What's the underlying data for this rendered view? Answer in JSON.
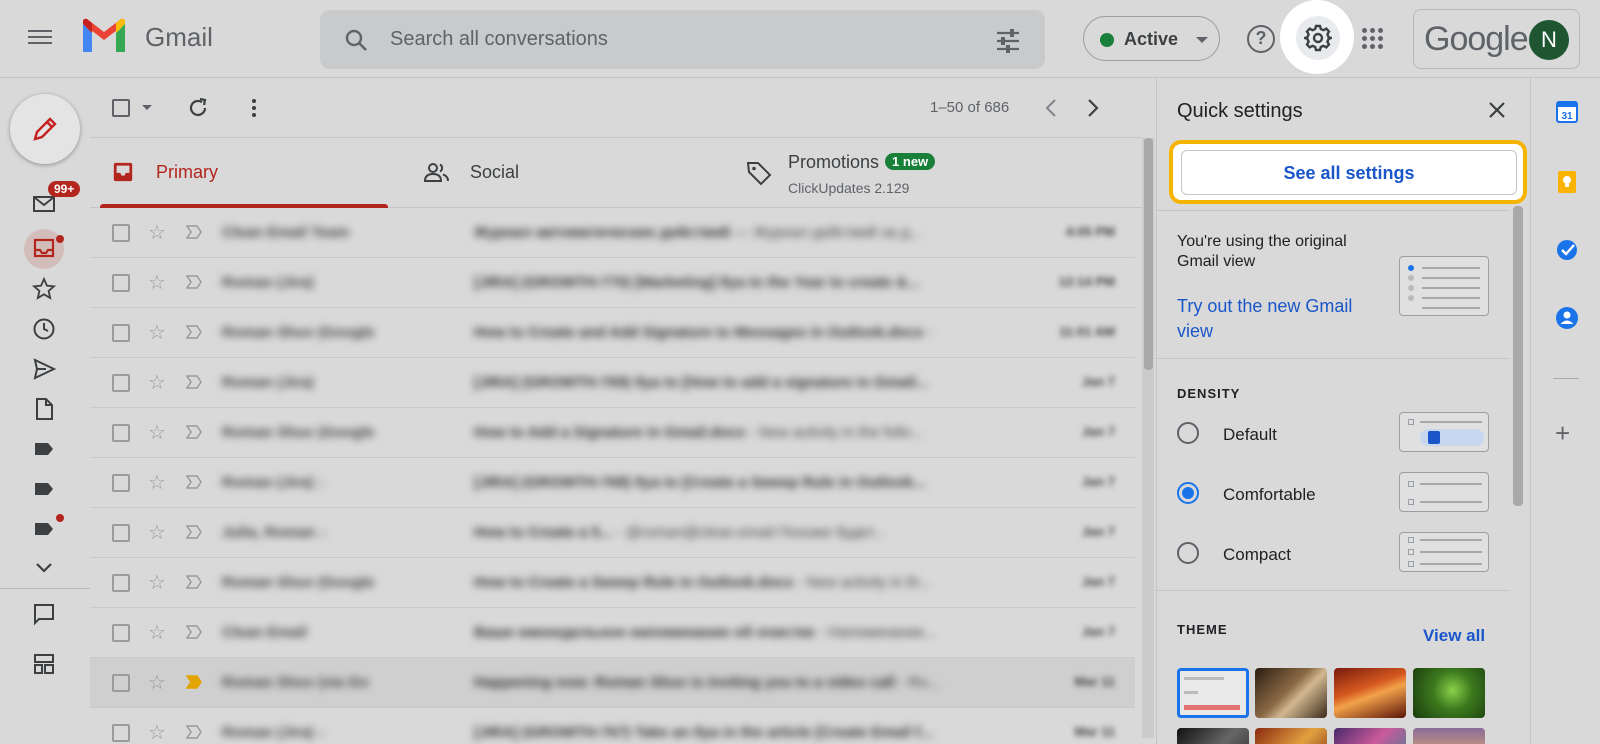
{
  "header": {
    "app_name": "Gmail",
    "search_placeholder": "Search all conversations",
    "status_label": "Active",
    "help_glyph": "?",
    "google_label": "Google",
    "avatar_initial": "N"
  },
  "rail": {
    "inbox_badge": "99+"
  },
  "toolbar": {
    "count": "1–50 of 686"
  },
  "tabs": [
    {
      "label": "Primary"
    },
    {
      "label": "Social"
    },
    {
      "label": "Promotions",
      "badge": "1 new",
      "subtitle": "ClickUpdates 2.129"
    }
  ],
  "emails": [
    {
      "sender": "Clean Email Team",
      "subject": "Журнал автоматических действий",
      "snippet": " — Журнал действий за д...",
      "date": "4:05 PM"
    },
    {
      "sender": "Roman (Jira)",
      "subject": "[JIRA] (GROWTH-770) [Marketing] Ilya to the Year to create &...",
      "snippet": "",
      "date": "12:14 PM"
    },
    {
      "sender": "Roman Shuv (Google",
      "subject": "How to Create and Add Signature to Messages in Outlook.docx",
      "snippet": " - ",
      "date": "11:01 AM"
    },
    {
      "sender": "Roman (Jira)",
      "subject": "[JIRA] (GROWTH-769) Ilya to [How to add a signature in Gmail...",
      "snippet": "",
      "date": "Jan 7"
    },
    {
      "sender": "Roman Shuv (Google",
      "subject": "How to Add a Signature in Gmail.docx",
      "snippet": " - New activity in the follo...",
      "date": "Jan 7"
    },
    {
      "sender": "Roman (Jira) ↓",
      "subject": "[JIRA] (GROWTH-768) Ilya to [Create a Sweep Rule in Outlook...",
      "snippet": "",
      "date": "Jan 7"
    },
    {
      "sender": "Julia, Roman ↓",
      "subject": "How to Create a 5...",
      "snippet": " - @roman@clean.email Похоже будет...",
      "date": "Jan 7"
    },
    {
      "sender": "Roman Shuv (Google",
      "subject": "How to Create a Sweep Rule in Outlook.docx",
      "snippet": " - New activity in th...",
      "date": "Jan 7"
    },
    {
      "sender": "Clean Email",
      "subject": "Ваше еженедельное напоминание об очистке",
      "snippet": " - Напоминание...",
      "date": "Jan 7"
    },
    {
      "sender": "Roman Shuv (via Go",
      "subject": "Happening now: Roman Shuv is inviting you to a video call",
      "snippet": " - Ro...",
      "date": "Mar 11"
    },
    {
      "sender": "Roman (Jira) ↓",
      "subject": "[JIRA] (GROWTH-767) Take an Ilya in the article [Create Email f...",
      "snippet": "",
      "date": "Mar 11"
    }
  ],
  "quick_settings": {
    "title": "Quick settings",
    "see_all": "See all settings",
    "view_text": "You're using the original Gmail view",
    "try_new": "Try out the new Gmail view",
    "density_heading": "DENSITY",
    "density_options": [
      {
        "label": "Default",
        "selected": false
      },
      {
        "label": "Comfortable",
        "selected": true
      },
      {
        "label": "Compact",
        "selected": false
      }
    ],
    "theme_heading": "THEME",
    "view_all": "View all"
  },
  "colors": {
    "accent_red": "#b3261e",
    "link_blue": "#1a56c9",
    "highlight_yellow": "#f5b400",
    "active_green": "#188038"
  }
}
